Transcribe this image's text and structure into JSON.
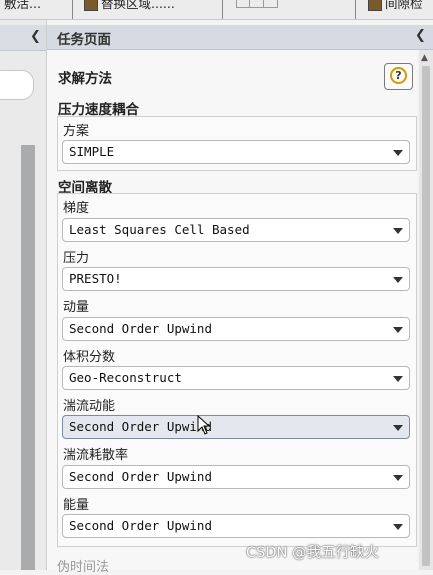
{
  "toolbar": {
    "item1": "敷活...",
    "item2": "替换区域......",
    "item3": "间隙检"
  },
  "task_panel": {
    "title": "任务页面",
    "section_title": "求解方法",
    "help_glyph": "?",
    "pressure_velocity": {
      "title": "压力速度耦合",
      "scheme_label": "方案",
      "scheme_value": "SIMPLE"
    },
    "spatial": {
      "title": "空间离散",
      "fields": [
        {
          "label": "梯度",
          "value": "Least Squares Cell Based"
        },
        {
          "label": "压力",
          "value": "PRESTO!"
        },
        {
          "label": "动量",
          "value": "Second Order Upwind"
        },
        {
          "label": "体积分数",
          "value": "Geo-Reconstruct"
        },
        {
          "label": "湍流动能",
          "value": "Second Order Upwind"
        },
        {
          "label": "湍流耗散率",
          "value": "Second Order Upwind"
        },
        {
          "label": "能量",
          "value": "Second Order Upwind"
        }
      ]
    },
    "next_section": "伪时间法"
  },
  "watermark": "CSDN @我五行缺火"
}
